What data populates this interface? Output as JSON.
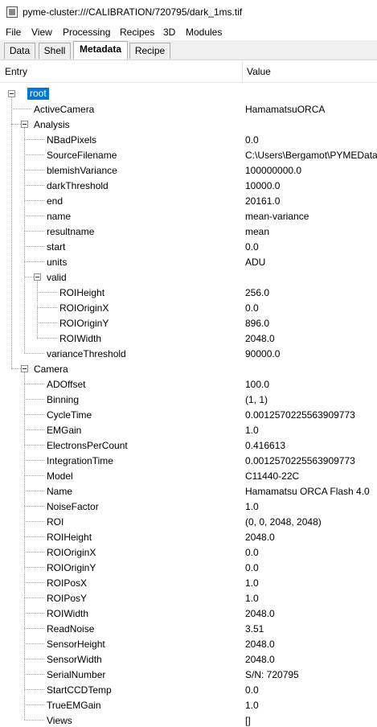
{
  "window": {
    "title": "pyme-cluster:///CALIBRATION/720795/dark_1ms.tif"
  },
  "menu": [
    "File",
    "View",
    "Processing",
    "Recipes",
    "3D",
    "Modules"
  ],
  "tabs": [
    "Data",
    "Shell",
    "Metadata",
    "Recipe"
  ],
  "active_tab": "Metadata",
  "columns": {
    "entry": "Entry",
    "value": "Value"
  },
  "rows": [
    {
      "entry": "root",
      "value": "",
      "level": 0,
      "expandable": true,
      "selected": true
    },
    {
      "entry": "ActiveCamera",
      "value": "HamamatsuORCA",
      "level": 1
    },
    {
      "entry": "Analysis",
      "value": "",
      "level": 1,
      "expandable": true
    },
    {
      "entry": "NBadPixels",
      "value": "0.0",
      "level": 2
    },
    {
      "entry": "SourceFilename",
      "value": "C:\\Users\\Bergamot\\PYMEData\\",
      "level": 2
    },
    {
      "entry": "blemishVariance",
      "value": "100000000.0",
      "level": 2
    },
    {
      "entry": "darkThreshold",
      "value": "10000.0",
      "level": 2
    },
    {
      "entry": "end",
      "value": "20161.0",
      "level": 2
    },
    {
      "entry": "name",
      "value": "mean-variance",
      "level": 2
    },
    {
      "entry": "resultname",
      "value": "mean",
      "level": 2
    },
    {
      "entry": "start",
      "value": "0.0",
      "level": 2
    },
    {
      "entry": "units",
      "value": "ADU",
      "level": 2
    },
    {
      "entry": "valid",
      "value": "",
      "level": 2,
      "expandable": true
    },
    {
      "entry": "ROIHeight",
      "value": "256.0",
      "level": 3
    },
    {
      "entry": "ROIOriginX",
      "value": "0.0",
      "level": 3
    },
    {
      "entry": "ROIOriginY",
      "value": "896.0",
      "level": 3
    },
    {
      "entry": "ROIWidth",
      "value": "2048.0",
      "level": 3
    },
    {
      "entry": "varianceThreshold",
      "value": "90000.0",
      "level": 2
    },
    {
      "entry": "Camera",
      "value": "",
      "level": 1,
      "expandable": true
    },
    {
      "entry": "ADOffset",
      "value": "100.0",
      "level": 2
    },
    {
      "entry": "Binning",
      "value": "(1, 1)",
      "level": 2
    },
    {
      "entry": "CycleTime",
      "value": "0.0012570225563909773",
      "level": 2
    },
    {
      "entry": "EMGain",
      "value": "1.0",
      "level": 2
    },
    {
      "entry": "ElectronsPerCount",
      "value": "0.416613",
      "level": 2
    },
    {
      "entry": "IntegrationTime",
      "value": "0.0012570225563909773",
      "level": 2
    },
    {
      "entry": "Model",
      "value": "C11440-22C",
      "level": 2
    },
    {
      "entry": "Name",
      "value": "Hamamatsu ORCA Flash 4.0",
      "level": 2
    },
    {
      "entry": "NoiseFactor",
      "value": "1.0",
      "level": 2
    },
    {
      "entry": "ROI",
      "value": "(0, 0, 2048, 2048)",
      "level": 2
    },
    {
      "entry": "ROIHeight",
      "value": "2048.0",
      "level": 2
    },
    {
      "entry": "ROIOriginX",
      "value": "0.0",
      "level": 2
    },
    {
      "entry": "ROIOriginY",
      "value": "0.0",
      "level": 2
    },
    {
      "entry": "ROIPosX",
      "value": "1.0",
      "level": 2
    },
    {
      "entry": "ROIPosY",
      "value": "1.0",
      "level": 2
    },
    {
      "entry": "ROIWidth",
      "value": "2048.0",
      "level": 2
    },
    {
      "entry": "ReadNoise",
      "value": "3.51",
      "level": 2
    },
    {
      "entry": "SensorHeight",
      "value": "2048.0",
      "level": 2
    },
    {
      "entry": "SensorWidth",
      "value": "2048.0",
      "level": 2
    },
    {
      "entry": "SerialNumber",
      "value": "S/N: 720795",
      "level": 2
    },
    {
      "entry": "StartCCDTemp",
      "value": "0.0",
      "level": 2
    },
    {
      "entry": "TrueEMGain",
      "value": "1.0",
      "level": 2
    },
    {
      "entry": "Views",
      "value": "[]",
      "level": 2
    }
  ],
  "colors": {
    "selection": "#0078d7",
    "tab_bg": "#f0f0f0"
  }
}
